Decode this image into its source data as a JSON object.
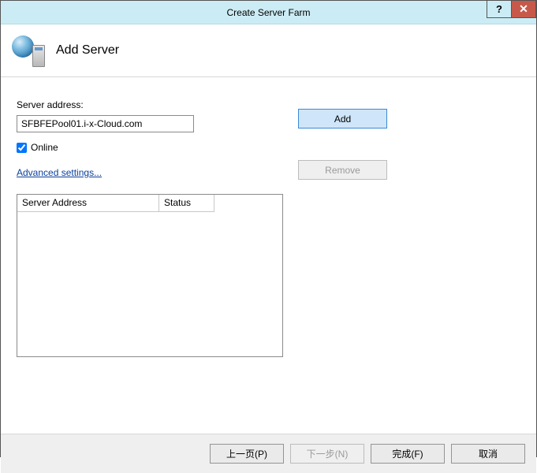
{
  "window": {
    "title": "Create Server Farm",
    "help_symbol": "?",
    "close_symbol": "✕"
  },
  "header": {
    "title": "Add Server"
  },
  "form": {
    "server_address_label": "Server address:",
    "server_address_value": "SFBFEPool01.i-x-Cloud.com",
    "online_checked": true,
    "online_label": "Online",
    "advanced_link": "Advanced settings..."
  },
  "actions": {
    "add": "Add",
    "remove": "Remove"
  },
  "table": {
    "col_address": "Server Address",
    "col_status": "Status",
    "rows": []
  },
  "footer": {
    "prev": "上一页(P)",
    "next": "下一步(N)",
    "finish": "完成(F)",
    "cancel": "取消"
  }
}
